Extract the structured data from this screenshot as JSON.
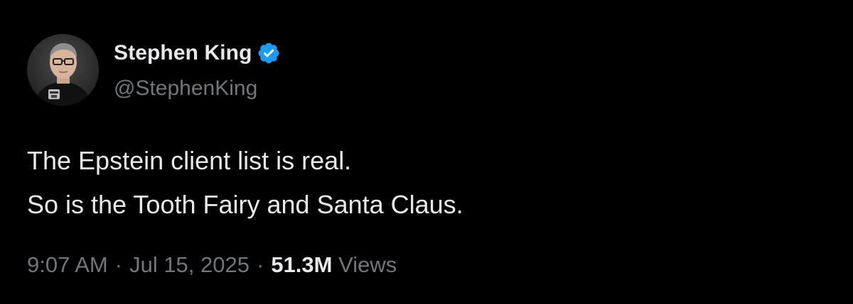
{
  "author": {
    "display_name": "Stephen King",
    "handle": "@StephenKing",
    "verified_icon": "verified-badge-icon",
    "verified_color": "#1d9bf0"
  },
  "tweet": {
    "lines": [
      "The Epstein client list is real.",
      "So is the Tooth Fairy and Santa Claus."
    ]
  },
  "meta": {
    "time": "9:07 AM",
    "separator": "·",
    "date": "Jul 15, 2025",
    "views_count": "51.3M",
    "views_label": "Views"
  },
  "colors": {
    "background": "#000000",
    "primary_text": "#e7e9ea",
    "secondary_text": "#71767b"
  }
}
